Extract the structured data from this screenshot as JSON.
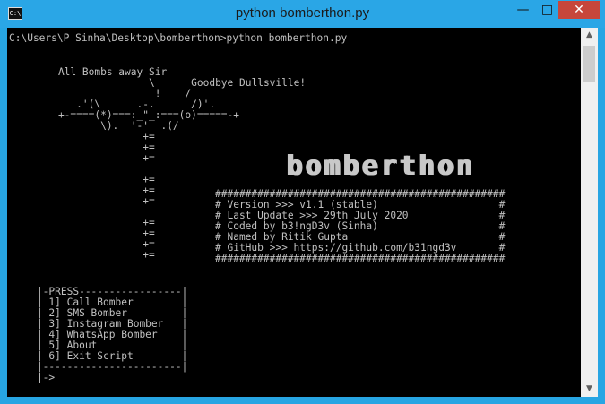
{
  "window": {
    "title": "python  bomberthon.py",
    "icon": "console-icon",
    "icon_text": "C:\\",
    "controls": {
      "minimize": "—",
      "maximize": "□",
      "close": "✕"
    }
  },
  "console": {
    "command_line": "C:\\Users\\P Sinha\\Desktop\\bomberthon>python bomberthon.py",
    "ascii_art": "    All Bombs away Sir\n                   \\      Goodbye Dullsville!\n                  __!__  /\n       .'(\\      .-.      /)'.\n    +-====(*)===:_\"_:===(o)=====-+\n           \\).  '-'  .(/\n                  +=\n                  +=\n                  +=\n\n                  +=\n                  +=\n                  +=\n\n                  +=\n                  +=\n                  +=\n                  +=",
    "logo": "bomberthon",
    "info_box": "################################################\n# Version >>> v1.1 (stable)                    #\n# Last Update >>> 29th July 2020               #\n# Coded by b3!ngD3v (Sinha)                    #\n# Named by Ritik Gupta                         #\n# GitHub >>> https://github.com/b31ngd3v       #\n################################################",
    "menu": "    |-PRESS-----------------|\n    | 1] Call Bomber        |\n    | 2] SMS Bomber         |\n    | 3] Instagram Bomber   |\n    | 4] WhatsApp Bomber    |\n    | 5] About              |\n    | 6] Exit Script        |\n    |-----------------------|\n    |",
    "prompt": "    |->"
  },
  "scrollbar": {
    "up_arrow": "▲",
    "down_arrow": "▼"
  }
}
